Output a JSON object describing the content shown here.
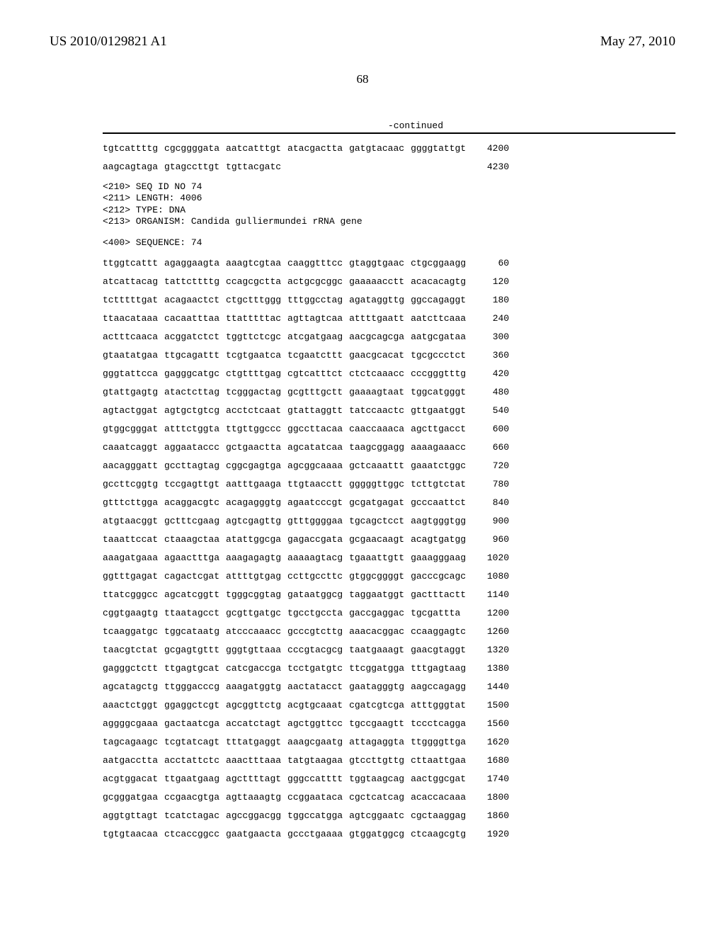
{
  "header": {
    "pub_number": "US 2010/0129821 A1",
    "pub_date": "May 27, 2010",
    "page_number": "68"
  },
  "continued_label": "-continued",
  "tail_rows": [
    {
      "blocks": [
        "tgtcattttg",
        "cgcggggata",
        "aatcatttgt",
        "atacgactta",
        "gatgtacaac",
        "ggggtattgt"
      ],
      "pos": "4200"
    },
    {
      "blocks": [
        "aagcagtaga",
        "gtagccttgt",
        "tgttacgatc",
        "",
        "",
        ""
      ],
      "pos": "4230"
    }
  ],
  "seq_header": {
    "lines": [
      "<210> SEQ ID NO 74",
      "<211> LENGTH: 4006",
      "<212> TYPE: DNA",
      "<213> ORGANISM: Candida gulliermundei rRNA gene"
    ],
    "sequence_label": "<400> SEQUENCE: 74"
  },
  "seq_rows": [
    {
      "blocks": [
        "ttggtcattt",
        "agaggaagta",
        "aaagtcgtaa",
        "caaggtttcc",
        "gtaggtgaac",
        "ctgcggaagg"
      ],
      "pos": "60"
    },
    {
      "blocks": [
        "atcattacag",
        "tattcttttg",
        "ccagcgctta",
        "actgcgcggc",
        "gaaaaacctt",
        "acacacagtg"
      ],
      "pos": "120"
    },
    {
      "blocks": [
        "tctttttgat",
        "acagaactct",
        "ctgctttggg",
        "tttggcctag",
        "agataggttg",
        "ggccagaggt"
      ],
      "pos": "180"
    },
    {
      "blocks": [
        "ttaacataaa",
        "cacaatttaa",
        "ttatttttac",
        "agttagtcaa",
        "attttgaatt",
        "aatcttcaaa"
      ],
      "pos": "240"
    },
    {
      "blocks": [
        "actttcaaca",
        "acggatctct",
        "tggttctcgc",
        "atcgatgaag",
        "aacgcagcga",
        "aatgcgataa"
      ],
      "pos": "300"
    },
    {
      "blocks": [
        "gtaatatgaa",
        "ttgcagattt",
        "tcgtgaatca",
        "tcgaatcttt",
        "gaacgcacat",
        "tgcgccctct"
      ],
      "pos": "360"
    },
    {
      "blocks": [
        "gggtattcca",
        "gagggcatgc",
        "ctgttttgag",
        "cgtcatttct",
        "ctctcaaacc",
        "cccgggtttg"
      ],
      "pos": "420"
    },
    {
      "blocks": [
        "gtattgagtg",
        "atactcttag",
        "tcgggactag",
        "gcgtttgctt",
        "gaaaagtaat",
        "tggcatgggt"
      ],
      "pos": "480"
    },
    {
      "blocks": [
        "agtactggat",
        "agtgctgtcg",
        "acctctcaat",
        "gtattaggtt",
        "tatccaactc",
        "gttgaatggt"
      ],
      "pos": "540"
    },
    {
      "blocks": [
        "gtggcgggat",
        "atttctggta",
        "ttgttggccc",
        "ggccttacaa",
        "caaccaaaca",
        "agcttgacct"
      ],
      "pos": "600"
    },
    {
      "blocks": [
        "caaatcaggt",
        "aggaataccc",
        "gctgaactta",
        "agcatatcaa",
        "taagcggagg",
        "aaaagaaacc"
      ],
      "pos": "660"
    },
    {
      "blocks": [
        "aacagggatt",
        "gccttagtag",
        "cggcgagtga",
        "agcggcaaaa",
        "gctcaaattt",
        "gaaatctggc"
      ],
      "pos": "720"
    },
    {
      "blocks": [
        "gccttcggtg",
        "tccgagttgt",
        "aatttgaaga",
        "ttgtaacctt",
        "gggggttggc",
        "tcttgtctat"
      ],
      "pos": "780"
    },
    {
      "blocks": [
        "gtttcttgga",
        "acaggacgtc",
        "acagagggtg",
        "agaatcccgt",
        "gcgatgagat",
        "gcccaattct"
      ],
      "pos": "840"
    },
    {
      "blocks": [
        "atgtaacggt",
        "gctttcgaag",
        "agtcgagttg",
        "gtttggggaa",
        "tgcagctcct",
        "aagtgggtgg"
      ],
      "pos": "900"
    },
    {
      "blocks": [
        "taaattccat",
        "ctaaagctaa",
        "atattggcga",
        "gagaccgata",
        "gcgaacaagt",
        "acagtgatgg"
      ],
      "pos": "960"
    },
    {
      "blocks": [
        "aaagatgaaa",
        "agaactttga",
        "aaagagagtg",
        "aaaaagtacg",
        "tgaaattgtt",
        "gaaagggaag"
      ],
      "pos": "1020"
    },
    {
      "blocks": [
        "ggtttgagat",
        "cagactcgat",
        "attttgtgag",
        "ccttgccttc",
        "gtggcggggt",
        "gacccgcagc"
      ],
      "pos": "1080"
    },
    {
      "blocks": [
        "ttatcgggcc",
        "agcatcggtt",
        "tgggcggtag",
        "gataatggcg",
        "taggaatggt",
        "gactttactt"
      ],
      "pos": "1140"
    },
    {
      "blocks": [
        "cggtgaagtg",
        "ttaatagcct",
        "gcgttgatgc",
        "tgcctgccta",
        "gaccgaggac",
        "tgcgattta"
      ],
      "pos": "1200"
    },
    {
      "blocks": [
        "tcaaggatgc",
        "tggcataatg",
        "atcccaaacc",
        "gcccgtcttg",
        "aaacacggac",
        "ccaaggagtc"
      ],
      "pos": "1260"
    },
    {
      "blocks": [
        "taacgtctat",
        "gcgagtgttt",
        "gggtgttaaa",
        "cccgtacgcg",
        "taatgaaagt",
        "gaacgtaggt"
      ],
      "pos": "1320"
    },
    {
      "blocks": [
        "gagggctctt",
        "ttgagtgcat",
        "catcgaccga",
        "tcctgatgtc",
        "ttcggatgga",
        "tttgagtaag"
      ],
      "pos": "1380"
    },
    {
      "blocks": [
        "agcatagctg",
        "ttgggacccg",
        "aaagatggtg",
        "aactatacct",
        "gaatagggtg",
        "aagccagagg"
      ],
      "pos": "1440"
    },
    {
      "blocks": [
        "aaactctggt",
        "ggaggctcgt",
        "agcggttctg",
        "acgtgcaaat",
        "cgatcgtcga",
        "atttgggtat"
      ],
      "pos": "1500"
    },
    {
      "blocks": [
        "aggggcgaaa",
        "gactaatcga",
        "accatctagt",
        "agctggttcc",
        "tgccgaagtt",
        "tccctcagga"
      ],
      "pos": "1560"
    },
    {
      "blocks": [
        "tagcagaagc",
        "tcgtatcagt",
        "tttatgaggt",
        "aaagcgaatg",
        "attagaggta",
        "ttggggttga"
      ],
      "pos": "1620"
    },
    {
      "blocks": [
        "aatgacctta",
        "acctattctc",
        "aaactttaaa",
        "tatgtaagaa",
        "gtccttgttg",
        "cttaattgaa"
      ],
      "pos": "1680"
    },
    {
      "blocks": [
        "acgtggacat",
        "ttgaatgaag",
        "agcttttagt",
        "gggccatttt",
        "tggtaagcag",
        "aactggcgat"
      ],
      "pos": "1740"
    },
    {
      "blocks": [
        "gcgggatgaa",
        "ccgaacgtga",
        "agttaaagtg",
        "ccggaataca",
        "cgctcatcag",
        "acaccacaaa"
      ],
      "pos": "1800"
    },
    {
      "blocks": [
        "aggtgttagt",
        "tcatctagac",
        "agccggacgg",
        "tggccatgga",
        "agtcggaatc",
        "cgctaaggag"
      ],
      "pos": "1860"
    },
    {
      "blocks": [
        "tgtgtaacaa",
        "ctcaccggcc",
        "gaatgaacta",
        "gccctgaaaa",
        "gtggatggcg",
        "ctcaagcgtg"
      ],
      "pos": "1920"
    }
  ]
}
